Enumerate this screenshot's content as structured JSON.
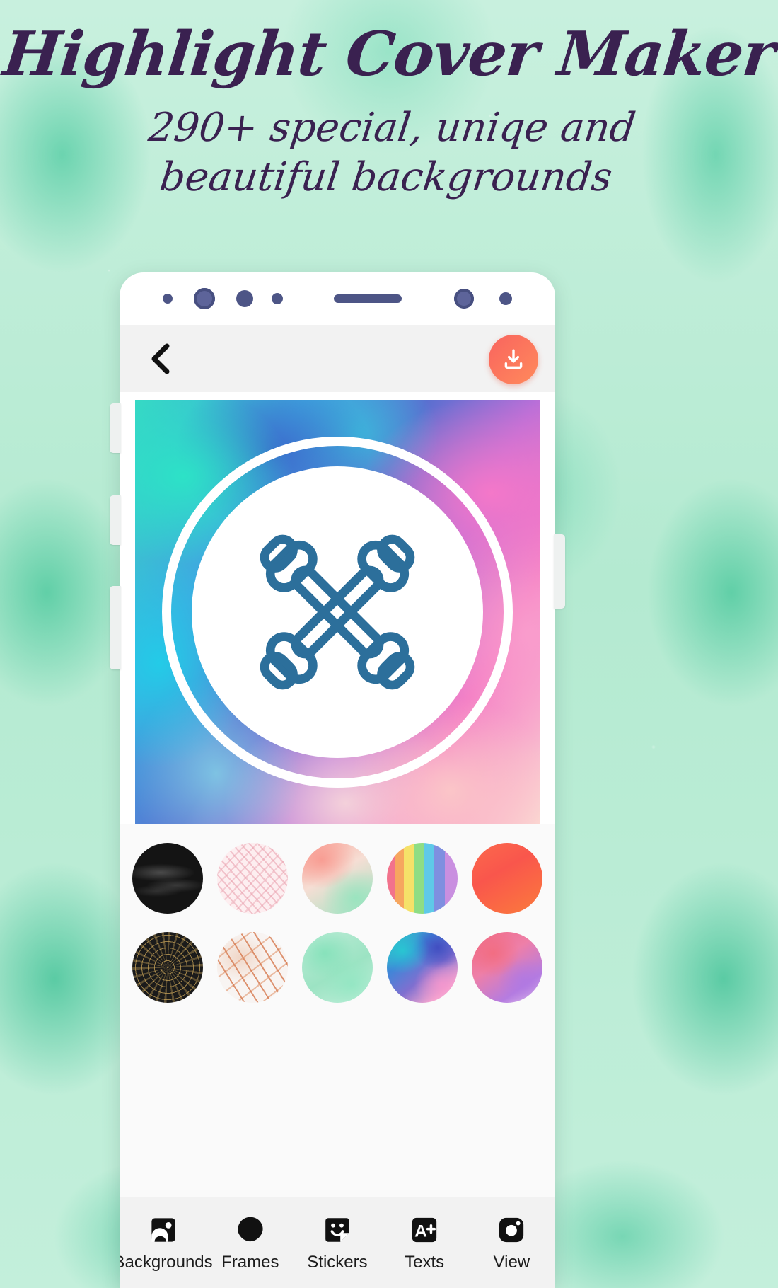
{
  "promo": {
    "title": "Highlight Cover Maker",
    "subtitle_line1": "290+ special, uniqe and",
    "subtitle_line2": "beautiful backgrounds",
    "title_color": "#3a2150",
    "backdrop_color": "#b4ead1"
  },
  "app": {
    "toolbar": {
      "back_icon": "chevron-left-icon",
      "download_icon": "download-icon",
      "download_button_color": "#fa6a5c"
    },
    "canvas": {
      "sticker_icon": "dumbbells-icon",
      "sticker_color": "#2c6f9b",
      "frame_shape": "circle-ring",
      "frame_color": "#ffffff",
      "background_name": "teal-pink-watercolor"
    },
    "picker": {
      "rows": [
        [
          {
            "name": "charcoal-chalk",
            "class": "bg-charcoal"
          },
          {
            "name": "pink-lace",
            "class": "bg-pinklace"
          },
          {
            "name": "peach-mint-watercolor",
            "class": "bg-peachmint"
          },
          {
            "name": "rainbow-stripes",
            "class": "bg-rainbow"
          },
          {
            "name": "orange-gradient",
            "class": "bg-orange"
          }
        ],
        [
          {
            "name": "black-gold-mandala",
            "class": "bg-gold"
          },
          {
            "name": "rose-gold-marble",
            "class": "bg-marble"
          },
          {
            "name": "mint-watercolor",
            "class": "bg-mint"
          },
          {
            "name": "teal-pink-watercolor",
            "class": "bg-tealpink"
          },
          {
            "name": "pink-purple-watercolor",
            "class": "bg-pinkpurple"
          }
        ]
      ]
    },
    "nav": [
      {
        "label": "Backgrounds",
        "icon": "image-icon"
      },
      {
        "label": "Frames",
        "icon": "blob-frame-icon"
      },
      {
        "label": "Stickers",
        "icon": "sticker-face-icon"
      },
      {
        "label": "Texts",
        "icon": "text-a-plus-icon"
      },
      {
        "label": "View",
        "icon": "instagram-camera-icon"
      }
    ]
  }
}
